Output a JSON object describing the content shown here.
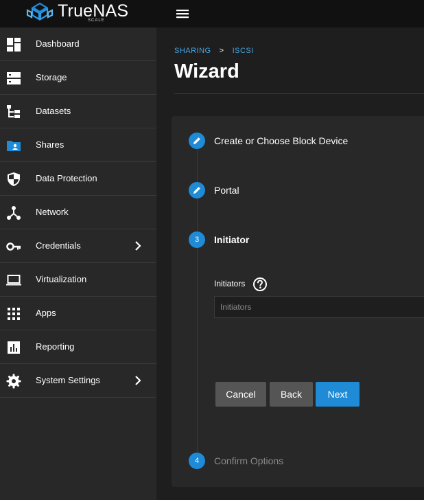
{
  "brand": {
    "name": "TrueNAS",
    "edition": "SCALE",
    "accent": "#1f8ad6"
  },
  "sidebar": {
    "items": [
      {
        "label": "Dashboard",
        "icon": "dashboard-icon"
      },
      {
        "label": "Storage",
        "icon": "storage-icon"
      },
      {
        "label": "Datasets",
        "icon": "datasets-icon"
      },
      {
        "label": "Shares",
        "icon": "shares-folder-icon",
        "active": true
      },
      {
        "label": "Data Protection",
        "icon": "shield-icon"
      },
      {
        "label": "Network",
        "icon": "network-icon"
      },
      {
        "label": "Credentials",
        "icon": "key-icon",
        "expandable": true
      },
      {
        "label": "Virtualization",
        "icon": "laptop-icon"
      },
      {
        "label": "Apps",
        "icon": "apps-grid-icon"
      },
      {
        "label": "Reporting",
        "icon": "reporting-chart-icon"
      },
      {
        "label": "System Settings",
        "icon": "gear-icon",
        "expandable": true
      }
    ]
  },
  "header": {
    "breadcrumb": [
      "SHARING",
      "ISCSI"
    ],
    "breadcrumb_sep": ">",
    "title": "Wizard"
  },
  "wizard": {
    "steps": [
      {
        "number": "1",
        "label": "Create or Choose Block Device",
        "state": "completed"
      },
      {
        "number": "2",
        "label": "Portal",
        "state": "completed"
      },
      {
        "number": "3",
        "label": "Initiator",
        "state": "active"
      },
      {
        "number": "4",
        "label": "Confirm Options",
        "state": "pending"
      }
    ],
    "initiators": {
      "label": "Initiators",
      "placeholder": "Initiators",
      "value": ""
    },
    "buttons": {
      "cancel": "Cancel",
      "back": "Back",
      "next": "Next"
    }
  }
}
